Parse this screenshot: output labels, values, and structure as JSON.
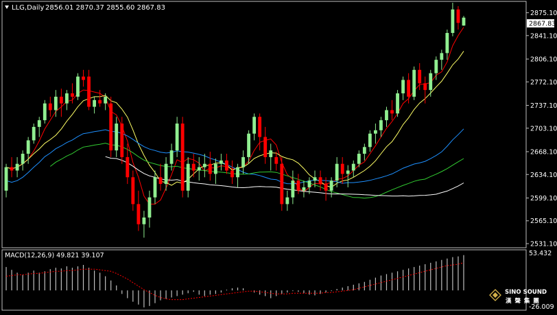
{
  "colors": {
    "background": "#000000",
    "frame": "#c0c0c0",
    "bull_candle": "#90ee90",
    "bear_candle": "#ff0000",
    "ma_fast": "#ff0000",
    "ma_mid": "#ffff66",
    "ma_slow1": "#1e90ff",
    "ma_slow2": "#32cd32",
    "ma_slow3": "#ffffff",
    "macd_hist": "#c0c0c0",
    "macd_signal": "#ff0000"
  },
  "header": {
    "symbol_timeframe": "LLG,Daily",
    "ohlc": "2856.01 2870.37 2855.60 2867.83"
  },
  "price_axis": {
    "ticks": [
      "2875.10",
      "2841.10",
      "2806.10",
      "2772.10",
      "2737.10",
      "2703.10",
      "2668.10",
      "2634.10",
      "2599.10",
      "2565.10",
      "2531.10"
    ],
    "current": "2867.83"
  },
  "macd_panel": {
    "label": "MACD(12,26,9) 49.821 39.107",
    "max_label": "53.432",
    "min_label": "-26.009"
  },
  "watermark": {
    "brand": "SINO SOUND",
    "cjk": "漢 聲 集 團"
  },
  "chart_data": {
    "type": "candlestick",
    "ylim": [
      2527,
      2890
    ],
    "candles": [
      [
        2610,
        2650,
        2600,
        2645
      ],
      [
        2645,
        2660,
        2630,
        2640
      ],
      [
        2640,
        2660,
        2630,
        2650
      ],
      [
        2650,
        2670,
        2640,
        2665
      ],
      [
        2665,
        2690,
        2650,
        2685
      ],
      [
        2685,
        2710,
        2680,
        2705
      ],
      [
        2705,
        2720,
        2690,
        2715
      ],
      [
        2715,
        2745,
        2710,
        2740
      ],
      [
        2740,
        2750,
        2720,
        2730
      ],
      [
        2730,
        2760,
        2720,
        2750
      ],
      [
        2750,
        2762,
        2720,
        2740
      ],
      [
        2740,
        2760,
        2730,
        2755
      ],
      [
        2755,
        2770,
        2740,
        2750
      ],
      [
        2750,
        2785,
        2745,
        2780
      ],
      [
        2780,
        2790,
        2765,
        2775
      ],
      [
        2780,
        2790,
        2730,
        2735
      ],
      [
        2735,
        2750,
        2725,
        2745
      ],
      [
        2745,
        2760,
        2735,
        2740
      ],
      [
        2740,
        2755,
        2730,
        2750
      ],
      [
        2740,
        2750,
        2660,
        2670
      ],
      [
        2670,
        2720,
        2660,
        2710
      ],
      [
        2710,
        2720,
        2650,
        2660
      ],
      [
        2660,
        2680,
        2620,
        2630
      ],
      [
        2630,
        2640,
        2580,
        2590
      ],
      [
        2590,
        2610,
        2550,
        2560
      ],
      [
        2560,
        2580,
        2540,
        2570
      ],
      [
        2570,
        2610,
        2555,
        2600
      ],
      [
        2600,
        2640,
        2590,
        2630
      ],
      [
        2630,
        2650,
        2610,
        2620
      ],
      [
        2620,
        2660,
        2610,
        2650
      ],
      [
        2650,
        2680,
        2640,
        2670
      ],
      [
        2670,
        2720,
        2660,
        2710
      ],
      [
        2710,
        2720,
        2600,
        2610
      ],
      [
        2610,
        2660,
        2600,
        2650
      ],
      [
        2650,
        2665,
        2630,
        2640
      ],
      [
        2640,
        2660,
        2625,
        2645
      ],
      [
        2645,
        2665,
        2630,
        2650
      ],
      [
        2650,
        2668,
        2625,
        2635
      ],
      [
        2635,
        2658,
        2620,
        2650
      ],
      [
        2650,
        2665,
        2640,
        2655
      ],
      [
        2655,
        2665,
        2635,
        2640
      ],
      [
        2640,
        2655,
        2620,
        2630
      ],
      [
        2630,
        2650,
        2615,
        2645
      ],
      [
        2645,
        2670,
        2635,
        2660
      ],
      [
        2660,
        2700,
        2650,
        2695
      ],
      [
        2695,
        2725,
        2685,
        2720
      ],
      [
        2720,
        2725,
        2670,
        2690
      ],
      [
        2690,
        2705,
        2650,
        2660
      ],
      [
        2660,
        2680,
        2640,
        2670
      ],
      [
        2660,
        2668,
        2640,
        2650
      ],
      [
        2650,
        2660,
        2580,
        2590
      ],
      [
        2590,
        2610,
        2580,
        2600
      ],
      [
        2600,
        2640,
        2590,
        2625
      ],
      [
        2625,
        2635,
        2605,
        2610
      ],
      [
        2610,
        2625,
        2600,
        2615
      ],
      [
        2615,
        2630,
        2605,
        2625
      ],
      [
        2625,
        2640,
        2615,
        2630
      ],
      [
        2630,
        2640,
        2610,
        2620
      ],
      [
        2620,
        2630,
        2595,
        2610
      ],
      [
        2610,
        2630,
        2600,
        2625
      ],
      [
        2625,
        2660,
        2615,
        2650
      ],
      [
        2650,
        2660,
        2620,
        2635
      ],
      [
        2635,
        2648,
        2615,
        2640
      ],
      [
        2640,
        2655,
        2630,
        2650
      ],
      [
        2650,
        2670,
        2645,
        2665
      ],
      [
        2665,
        2680,
        2655,
        2675
      ],
      [
        2675,
        2700,
        2668,
        2695
      ],
      [
        2695,
        2710,
        2680,
        2700
      ],
      [
        2700,
        2720,
        2690,
        2715
      ],
      [
        2715,
        2735,
        2705,
        2730
      ],
      [
        2730,
        2745,
        2715,
        2725
      ],
      [
        2725,
        2760,
        2720,
        2755
      ],
      [
        2755,
        2780,
        2745,
        2775
      ],
      [
        2775,
        2785,
        2740,
        2750
      ],
      [
        2750,
        2795,
        2745,
        2790
      ],
      [
        2790,
        2800,
        2760,
        2770
      ],
      [
        2770,
        2780,
        2740,
        2760
      ],
      [
        2760,
        2790,
        2750,
        2785
      ],
      [
        2785,
        2810,
        2775,
        2805
      ],
      [
        2805,
        2820,
        2790,
        2815
      ],
      [
        2815,
        2850,
        2805,
        2845
      ],
      [
        2845,
        2890,
        2840,
        2880
      ],
      [
        2880,
        2885,
        2850,
        2860
      ],
      [
        2856.01,
        2870.37,
        2855.6,
        2867.83
      ]
    ],
    "macd_hist": [
      33,
      29,
      25,
      22,
      25,
      28,
      25,
      27,
      30,
      32,
      31,
      34,
      32,
      34,
      36,
      32,
      28,
      25,
      20,
      14,
      7,
      -5,
      -11,
      -16,
      -20,
      -24,
      -22,
      -18,
      -14,
      -12,
      -10,
      -8,
      -6,
      -4,
      -2,
      -6,
      -8,
      -6,
      -5,
      -3,
      1,
      3,
      4,
      3,
      0,
      -3,
      -6,
      -8,
      -11,
      -8,
      -5,
      -3,
      -1,
      -2,
      -4,
      -6,
      -7,
      -5,
      -3,
      -1,
      2,
      4,
      6,
      8,
      10,
      12,
      15,
      18,
      21,
      23,
      25,
      27,
      29,
      31,
      33,
      35,
      37,
      39,
      41,
      43,
      45,
      47,
      48,
      49.821
    ],
    "macd_signal": [
      20,
      21,
      22,
      22,
      23,
      24,
      24,
      25,
      26,
      27,
      27,
      28,
      28,
      29,
      30,
      30,
      30,
      29,
      28,
      27,
      24,
      20,
      16,
      11,
      6,
      1,
      -3,
      -7,
      -10,
      -12,
      -13,
      -13,
      -13,
      -12,
      -11,
      -10,
      -9,
      -8,
      -7,
      -6,
      -5,
      -4,
      -3,
      -2,
      -1,
      -1,
      -2,
      -3,
      -4,
      -5,
      -5,
      -5,
      -4,
      -4,
      -4,
      -4,
      -4,
      -4,
      -3,
      -3,
      -2,
      -1,
      0,
      1,
      3,
      5,
      7,
      9,
      11,
      13,
      15,
      17,
      19,
      21,
      23,
      25,
      27,
      29,
      31,
      33,
      35,
      36,
      37,
      39.107
    ],
    "macd_ylim": [
      -26.009,
      53.432
    ]
  }
}
